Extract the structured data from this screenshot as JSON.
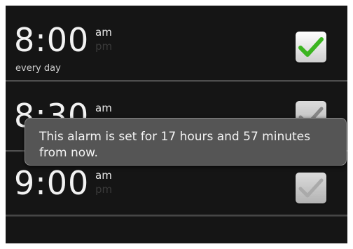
{
  "alarms": [
    {
      "time": "8:00",
      "am": "am",
      "pm": "pm",
      "repeat": "every day",
      "enabled": true,
      "check_color": "#3cb521"
    },
    {
      "time": "8:30",
      "am": "am",
      "pm": "pm",
      "repeat": "",
      "enabled": true,
      "check_color": "#9a9a9a"
    },
    {
      "time": "9:00",
      "am": "am",
      "pm": "pm",
      "repeat": "",
      "enabled": false,
      "check_color": "#bdbdbd"
    }
  ],
  "toast": {
    "message": "This alarm is set for 17 hours and 57 minutes from now."
  },
  "icons": {
    "checkbox": "checkmark-icon"
  },
  "colors": {
    "background": "#151515",
    "toast_bg": "#555555",
    "accent_check": "#3cb521"
  }
}
